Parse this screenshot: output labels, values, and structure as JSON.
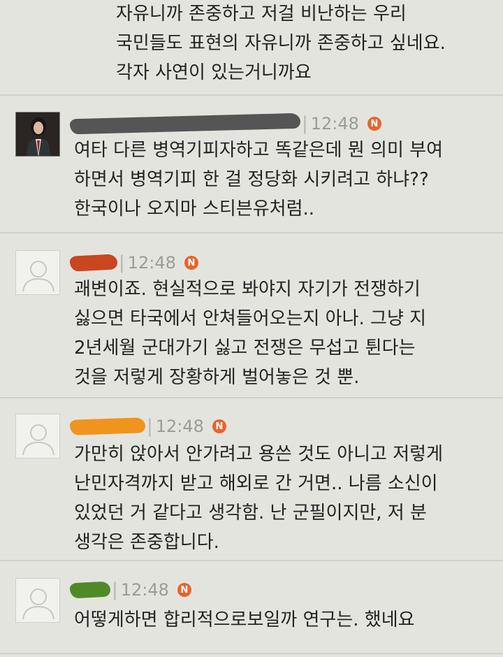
{
  "comments": [
    {
      "lines": [
        "자유니까 존중하고 저걸 비난하는 우리",
        "국민들도 표현의 자유니까 존중하고 싶네요.",
        "각자 사연이 있는거니까요"
      ]
    },
    {
      "time": "12:48",
      "badge": "N",
      "avatar": "profile-photo",
      "redaction_color": "#555555",
      "lines": [
        "여타 다른 병역기피자하고 똑같은데 뭔 의미 부여",
        "하면서 병역기피 한 걸 정당화 시키려고 하냐??",
        "한국이나 오지마 스티븐유처럼.."
      ]
    },
    {
      "time": "12:48",
      "badge": "N",
      "avatar": "default-user-icon",
      "redaction_color": "#c9461e",
      "lines": [
        "괘변이죠. 현실적으로 봐야지 자기가 전쟁하기",
        "싫으면 타국에서 안쳐들어오는지 아나. 그냥 지",
        "2년세월 군대가기 싫고 전쟁은 무섭고 튄다는",
        "것을 저렇게 장황하게 벌어놓은 것 뿐."
      ]
    },
    {
      "time": "12:48",
      "badge": "N",
      "avatar": "default-user-icon",
      "redaction_color": "#f0941e",
      "lines": [
        "가만히 앉아서 안가려고 용쓴 것도 아니고 저렇게",
        "난민자격까지 받고 해외로 간 거면.. 나름 소신이",
        "있었던 거 같다고 생각함. 난 군필이지만, 저 분",
        "생각은 존중합니다."
      ]
    },
    {
      "time": "12:48",
      "badge": "N",
      "avatar": "default-user-icon",
      "redaction_color": "#4f8a28",
      "lines": [
        "어떻게하면 합리적으로보일까 연구는. 했네요"
      ]
    }
  ],
  "colors": {
    "background": "#e4e4df",
    "badge": "#e8642c",
    "time": "#9c9c97"
  }
}
